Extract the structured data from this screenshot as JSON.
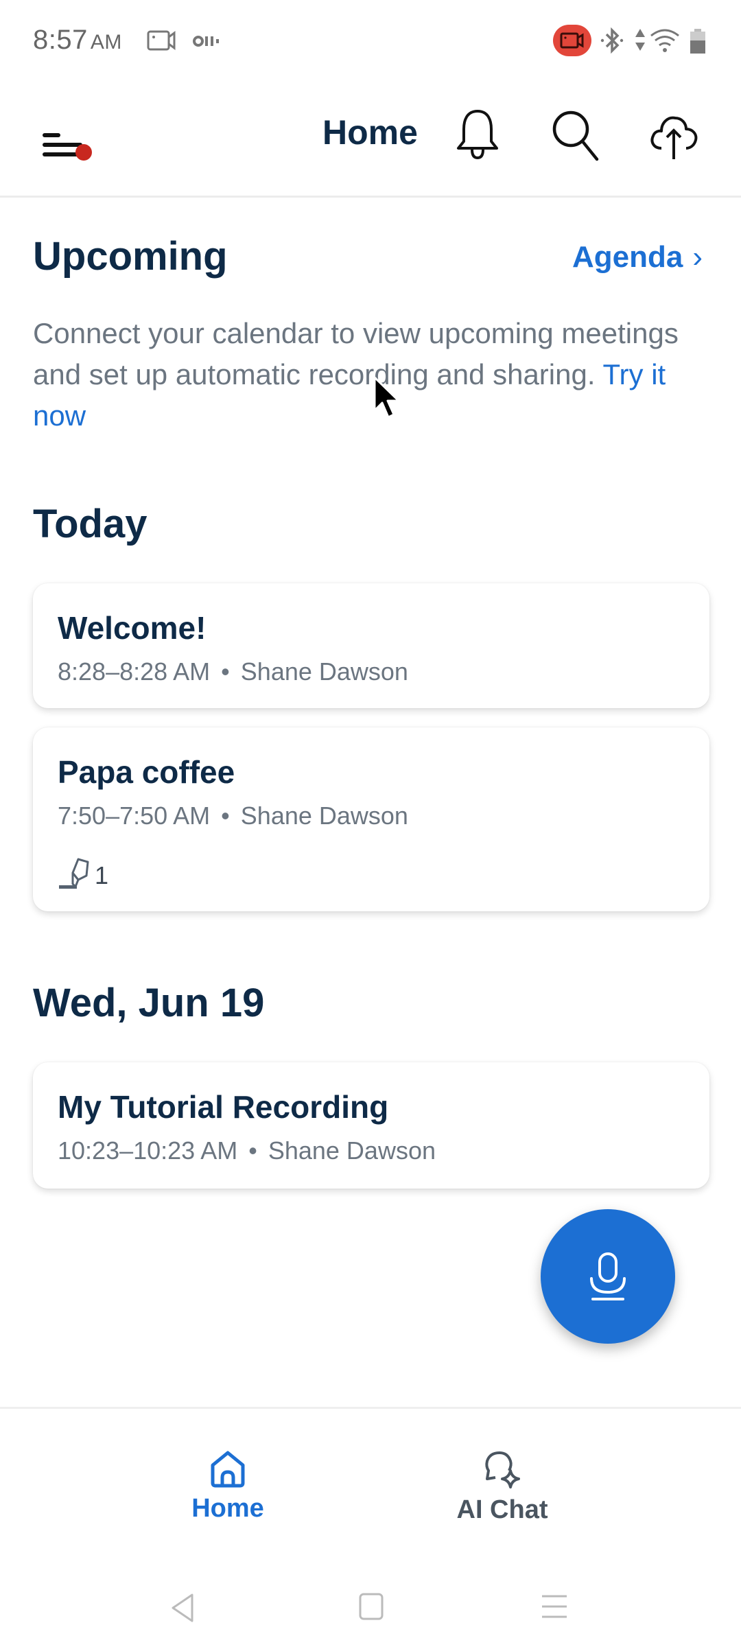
{
  "status_bar": {
    "time": "8:57",
    "ampm": "AM",
    "icons": [
      "screen-record-icon",
      "recording-indicator-icon",
      "active-recording-pill-icon",
      "bluetooth-icon",
      "data-arrows-icon",
      "wifi-icon",
      "battery-icon"
    ]
  },
  "header": {
    "title": "Home",
    "menu_has_notification_dot": true,
    "actions": [
      "notifications",
      "search",
      "upload"
    ]
  },
  "upcoming": {
    "title": "Upcoming",
    "agenda_link": "Agenda",
    "agenda_chevron": "›",
    "description": "Connect your calendar to view upcoming meetings and set up automatic recording and sharing.",
    "cta": "Try it now"
  },
  "groups": [
    {
      "heading": "Today",
      "items": [
        {
          "title": "Welcome!",
          "time": "8:28–8:28 AM",
          "owner": "Shane Dawson"
        },
        {
          "title": "Papa coffee",
          "time": "7:50–7:50 AM",
          "owner": "Shane Dawson",
          "highlights": "1"
        }
      ]
    },
    {
      "heading": "Wed, Jun 19",
      "items": [
        {
          "title": "My Tutorial Recording",
          "time": "10:23–10:23 AM",
          "owner": "Shane Dawson"
        }
      ]
    }
  ],
  "meta_separator": "•",
  "fab": {
    "icon": "microphone-icon",
    "action": "record"
  },
  "bottom_nav": {
    "items": [
      {
        "label": "Home",
        "icon": "home-icon",
        "active": true
      },
      {
        "label": "AI Chat",
        "icon": "ai-chat-icon",
        "active": false
      }
    ]
  },
  "colors": {
    "accent": "#1c6fd3",
    "heading": "#0e2a47",
    "muted": "#6b7580",
    "notification_dot": "#c8281f",
    "recording_pill": "#e2463a"
  }
}
